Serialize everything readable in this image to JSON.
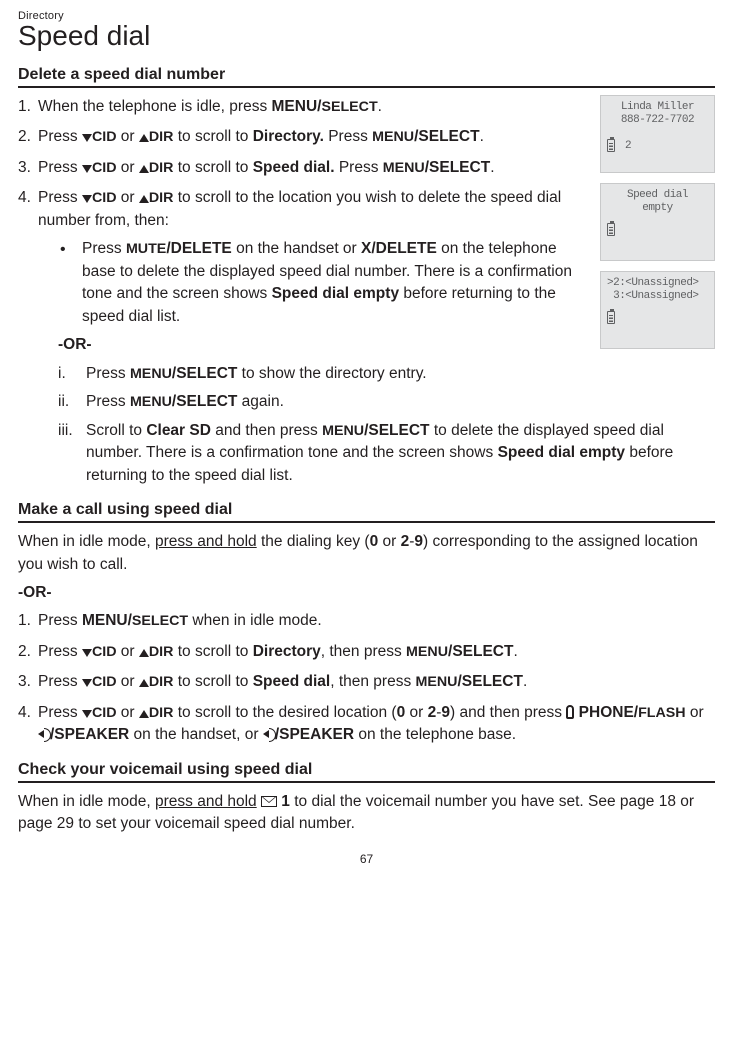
{
  "chapter": "Directory",
  "title": "Speed dial",
  "section1": {
    "heading": "Delete a speed dial number",
    "step1_a": "When the telephone is idle, press ",
    "step1_b": "MENU/",
    "step1_c": "SELECT",
    "step1_d": ".",
    "step2_a": "Press ",
    "step2_cid": "CID",
    "step2_or": " or ",
    "step2_dir": "DIR",
    "step2_b": " to scroll to ",
    "step2_target": "Directory.",
    "step2_c": " Press ",
    "step2_menu": "MENU",
    "step2_sel": "/SELECT",
    "step2_d": ".",
    "step3_a": "Press ",
    "step3_b": " to scroll to ",
    "step3_target": "Speed dial.",
    "step3_c": " Press ",
    "step4_a": "Press ",
    "step4_b": " to scroll to the location you wish to delete the speed dial number from, then:",
    "bullet_a": "Press ",
    "bullet_mute": "MUTE",
    "bullet_del": "/DELETE",
    "bullet_b": " on the handset or ",
    "bullet_xdel": "X/DELETE",
    "bullet_c": " on the telephone base to delete the displayed speed dial number. There is a confirmation tone and the screen shows ",
    "bullet_sde": "Speed dial empty",
    "bullet_d": " before returning to the speed dial list.",
    "or": "-OR-",
    "r1_a": "Press ",
    "r1_b": " to show the directory entry.",
    "r2_a": "Press ",
    "r2_b": " again.",
    "r3_a": "Scroll to ",
    "r3_clear": "Clear SD",
    "r3_b": " and then press ",
    "r3_c": " to delete the displayed speed dial number. There is a confirmation tone and the screen shows ",
    "r3_d": " before returning to the speed dial list."
  },
  "section2": {
    "heading": "Make a call using speed dial",
    "intro_a": "When in idle mode, ",
    "intro_ph": "press and hold",
    "intro_b": " the dialing key (",
    "zero": "0",
    "intro_or": " or ",
    "two": "2",
    "dash": "-",
    "nine": "9",
    "intro_c": ") corresponding to the assigned location you wish to call.",
    "or": "-OR-",
    "s1_a": "Press ",
    "s1_b": "MENU/",
    "s1_c": " when in idle mode.",
    "s2_b": " to scroll to ",
    "s2_dir": "Directory",
    "s2_c": ", then press ",
    "s3_sd": "Speed dial",
    "s4_b": " to scroll to the desired location (",
    "s4_c": ") and then press ",
    "s4_phone": " PHONE/",
    "s4_flash": "FLASH",
    "s4_or": " or ",
    "s4_spk": "/SPEAKER",
    "s4_d": " on the handset, or ",
    "s4_e": " on the telephone base."
  },
  "section3": {
    "heading": "Check your voicemail using speed dial",
    "a": "When in idle mode, ",
    "one": " 1",
    "b": " to dial the voicemail number you have set. See page 18 or page 29 to set your voicemail speed dial number."
  },
  "screens": {
    "s1_l1": "Linda Miller",
    "s1_l2": "888-722-7702",
    "s1_bl": "2",
    "s2_l1": "Speed dial",
    "s2_l2": "empty",
    "s3_l1": ">2:<Unassigned>",
    "s3_l2": " 3:<Unassigned>"
  },
  "pagenum": "67"
}
